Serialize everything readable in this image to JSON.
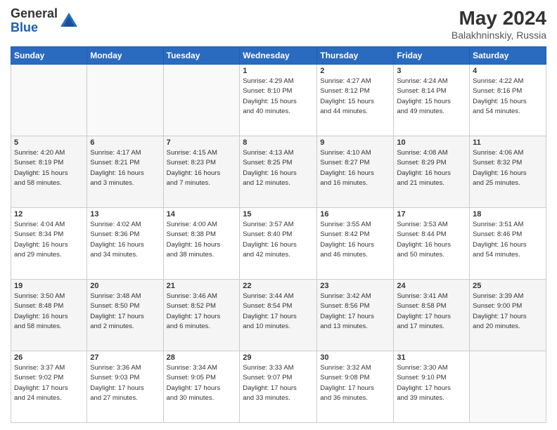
{
  "header": {
    "logo_general": "General",
    "logo_blue": "Blue",
    "month_year": "May 2024",
    "location": "Balakhninskiy, Russia"
  },
  "days_of_week": [
    "Sunday",
    "Monday",
    "Tuesday",
    "Wednesday",
    "Thursday",
    "Friday",
    "Saturday"
  ],
  "weeks": [
    [
      {
        "day": "",
        "info": ""
      },
      {
        "day": "",
        "info": ""
      },
      {
        "day": "",
        "info": ""
      },
      {
        "day": "1",
        "info": "Sunrise: 4:29 AM\nSunset: 8:10 PM\nDaylight: 15 hours\nand 40 minutes."
      },
      {
        "day": "2",
        "info": "Sunrise: 4:27 AM\nSunset: 8:12 PM\nDaylight: 15 hours\nand 44 minutes."
      },
      {
        "day": "3",
        "info": "Sunrise: 4:24 AM\nSunset: 8:14 PM\nDaylight: 15 hours\nand 49 minutes."
      },
      {
        "day": "4",
        "info": "Sunrise: 4:22 AM\nSunset: 8:16 PM\nDaylight: 15 hours\nand 54 minutes."
      }
    ],
    [
      {
        "day": "5",
        "info": "Sunrise: 4:20 AM\nSunset: 8:19 PM\nDaylight: 15 hours\nand 58 minutes."
      },
      {
        "day": "6",
        "info": "Sunrise: 4:17 AM\nSunset: 8:21 PM\nDaylight: 16 hours\nand 3 minutes."
      },
      {
        "day": "7",
        "info": "Sunrise: 4:15 AM\nSunset: 8:23 PM\nDaylight: 16 hours\nand 7 minutes."
      },
      {
        "day": "8",
        "info": "Sunrise: 4:13 AM\nSunset: 8:25 PM\nDaylight: 16 hours\nand 12 minutes."
      },
      {
        "day": "9",
        "info": "Sunrise: 4:10 AM\nSunset: 8:27 PM\nDaylight: 16 hours\nand 16 minutes."
      },
      {
        "day": "10",
        "info": "Sunrise: 4:08 AM\nSunset: 8:29 PM\nDaylight: 16 hours\nand 21 minutes."
      },
      {
        "day": "11",
        "info": "Sunrise: 4:06 AM\nSunset: 8:32 PM\nDaylight: 16 hours\nand 25 minutes."
      }
    ],
    [
      {
        "day": "12",
        "info": "Sunrise: 4:04 AM\nSunset: 8:34 PM\nDaylight: 16 hours\nand 29 minutes."
      },
      {
        "day": "13",
        "info": "Sunrise: 4:02 AM\nSunset: 8:36 PM\nDaylight: 16 hours\nand 34 minutes."
      },
      {
        "day": "14",
        "info": "Sunrise: 4:00 AM\nSunset: 8:38 PM\nDaylight: 16 hours\nand 38 minutes."
      },
      {
        "day": "15",
        "info": "Sunrise: 3:57 AM\nSunset: 8:40 PM\nDaylight: 16 hours\nand 42 minutes."
      },
      {
        "day": "16",
        "info": "Sunrise: 3:55 AM\nSunset: 8:42 PM\nDaylight: 16 hours\nand 46 minutes."
      },
      {
        "day": "17",
        "info": "Sunrise: 3:53 AM\nSunset: 8:44 PM\nDaylight: 16 hours\nand 50 minutes."
      },
      {
        "day": "18",
        "info": "Sunrise: 3:51 AM\nSunset: 8:46 PM\nDaylight: 16 hours\nand 54 minutes."
      }
    ],
    [
      {
        "day": "19",
        "info": "Sunrise: 3:50 AM\nSunset: 8:48 PM\nDaylight: 16 hours\nand 58 minutes."
      },
      {
        "day": "20",
        "info": "Sunrise: 3:48 AM\nSunset: 8:50 PM\nDaylight: 17 hours\nand 2 minutes."
      },
      {
        "day": "21",
        "info": "Sunrise: 3:46 AM\nSunset: 8:52 PM\nDaylight: 17 hours\nand 6 minutes."
      },
      {
        "day": "22",
        "info": "Sunrise: 3:44 AM\nSunset: 8:54 PM\nDaylight: 17 hours\nand 10 minutes."
      },
      {
        "day": "23",
        "info": "Sunrise: 3:42 AM\nSunset: 8:56 PM\nDaylight: 17 hours\nand 13 minutes."
      },
      {
        "day": "24",
        "info": "Sunrise: 3:41 AM\nSunset: 8:58 PM\nDaylight: 17 hours\nand 17 minutes."
      },
      {
        "day": "25",
        "info": "Sunrise: 3:39 AM\nSunset: 9:00 PM\nDaylight: 17 hours\nand 20 minutes."
      }
    ],
    [
      {
        "day": "26",
        "info": "Sunrise: 3:37 AM\nSunset: 9:02 PM\nDaylight: 17 hours\nand 24 minutes."
      },
      {
        "day": "27",
        "info": "Sunrise: 3:36 AM\nSunset: 9:03 PM\nDaylight: 17 hours\nand 27 minutes."
      },
      {
        "day": "28",
        "info": "Sunrise: 3:34 AM\nSunset: 9:05 PM\nDaylight: 17 hours\nand 30 minutes."
      },
      {
        "day": "29",
        "info": "Sunrise: 3:33 AM\nSunset: 9:07 PM\nDaylight: 17 hours\nand 33 minutes."
      },
      {
        "day": "30",
        "info": "Sunrise: 3:32 AM\nSunset: 9:08 PM\nDaylight: 17 hours\nand 36 minutes."
      },
      {
        "day": "31",
        "info": "Sunrise: 3:30 AM\nSunset: 9:10 PM\nDaylight: 17 hours\nand 39 minutes."
      },
      {
        "day": "",
        "info": ""
      }
    ]
  ]
}
